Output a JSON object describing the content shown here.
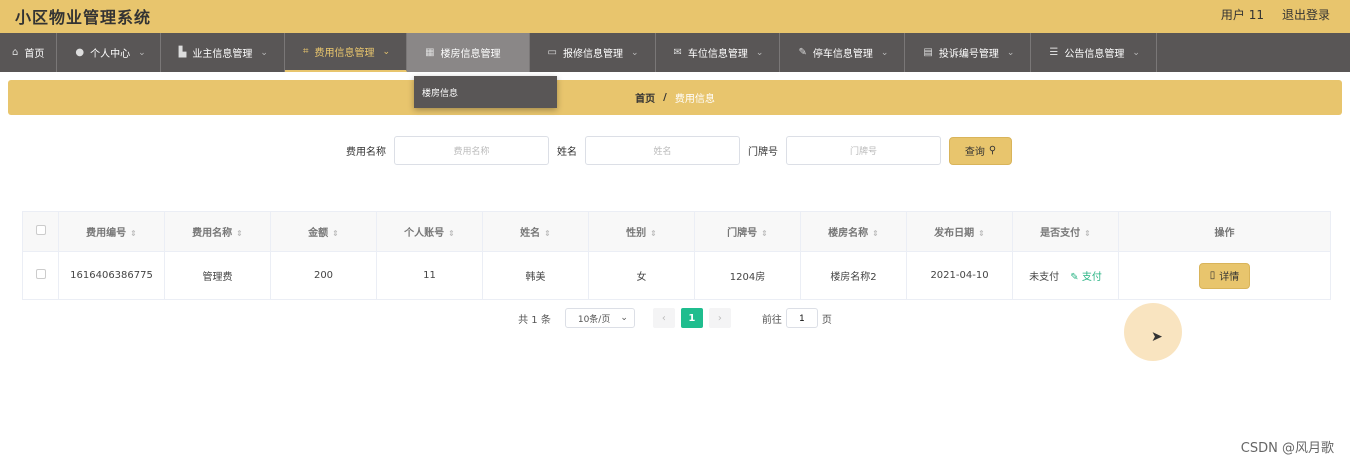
{
  "app": {
    "title": "小区物业管理系统"
  },
  "header": {
    "user": "用户 11",
    "logout": "退出登录"
  },
  "nav": [
    {
      "label": "首页",
      "icon": "home-icon",
      "has_dropdown": false
    },
    {
      "label": "个人中心",
      "icon": "person-icon",
      "has_dropdown": true
    },
    {
      "label": "业主信息管理",
      "icon": "building-icon",
      "has_dropdown": true
    },
    {
      "label": "费用信息管理",
      "icon": "crop-icon",
      "has_dropdown": true,
      "active": true
    },
    {
      "label": "楼房信息管理",
      "icon": "grid-icon",
      "has_dropdown": true,
      "hover": true
    },
    {
      "label": "报修信息管理",
      "icon": "chat-icon",
      "has_dropdown": true
    },
    {
      "label": "车位信息管理",
      "icon": "mail-icon",
      "has_dropdown": true
    },
    {
      "label": "停车信息管理",
      "icon": "edit-icon",
      "has_dropdown": true
    },
    {
      "label": "投诉编号管理",
      "icon": "bag-icon",
      "has_dropdown": true
    },
    {
      "label": "公告信息管理",
      "icon": "sliders-icon",
      "has_dropdown": true
    }
  ],
  "dropdown": {
    "item": "楼房信息"
  },
  "breadcrumb": {
    "home": "首页",
    "separator": "/",
    "current": "费用信息"
  },
  "search": {
    "fee_name_label": "费用名称",
    "fee_name_placeholder": "费用名称",
    "name_label": "姓名",
    "name_placeholder": "姓名",
    "door_label": "门牌号",
    "door_placeholder": "门牌号",
    "query_button": "查询"
  },
  "table": {
    "columns": [
      "费用编号",
      "费用名称",
      "金额",
      "个人账号",
      "姓名",
      "性别",
      "门牌号",
      "楼房名称",
      "发布日期",
      "是否支付",
      "操作"
    ],
    "rows": [
      {
        "fee_id": "1616406386775",
        "fee_name": "管理费",
        "amount": "200",
        "account": "11",
        "name": "韩美",
        "gender": "女",
        "door": "1204房",
        "building": "楼房名称2",
        "date": "2021-04-10",
        "paid": "未支付",
        "pay_link": "支付",
        "detail_button": "详情"
      }
    ]
  },
  "pagination": {
    "total": "共 1 条",
    "page_size": "10条/页",
    "current_page": "1",
    "goto_label": "前往",
    "goto_value": "1",
    "page_suffix": "页"
  },
  "watermark": "CSDN @风月歌",
  "colors": {
    "accent": "#e8c56d",
    "nav_bg": "#595656",
    "pager_active": "#1fbd8e",
    "pay_link": "#27b383"
  }
}
